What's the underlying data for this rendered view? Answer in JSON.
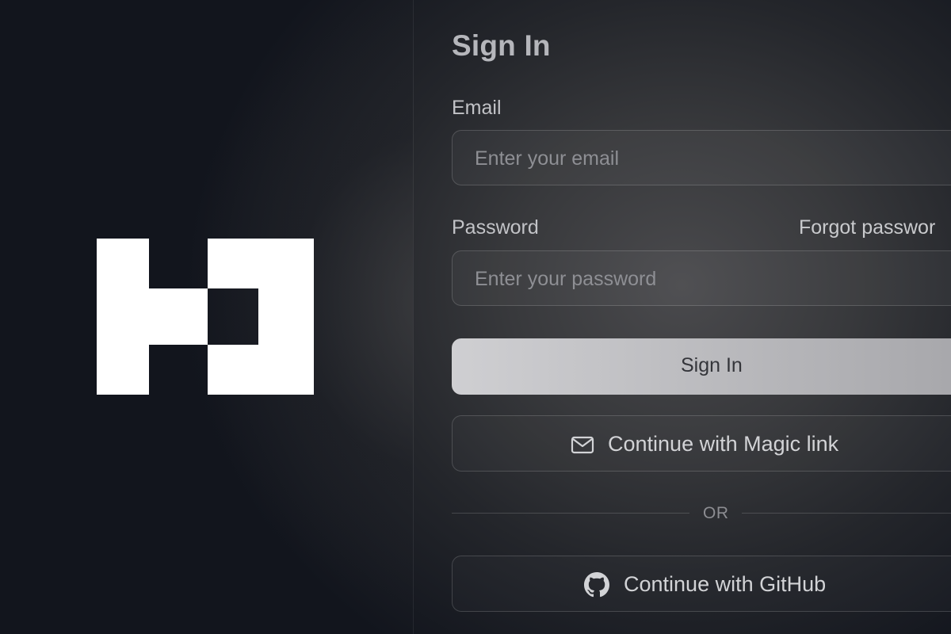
{
  "brand": {
    "logo_icon": "brand-logo-icon"
  },
  "signin": {
    "title": "Sign In",
    "email_label": "Email",
    "email_placeholder": "Enter your email",
    "email_value": "",
    "password_label": "Password",
    "forgot_password": "Forgot passwor",
    "password_placeholder": "Enter your password",
    "password_value": "",
    "submit_label": "Sign In",
    "magic_link_label": "Continue with Magic link",
    "magic_link_icon": "mail-icon",
    "divider_text": "OR",
    "github_label": "Continue with GitHub",
    "github_icon": "github-icon"
  },
  "colors": {
    "background": "#0e121b",
    "panel": "#3a3b3e",
    "primary_button": "#c4c4c8",
    "text": "#c2c3c7"
  }
}
